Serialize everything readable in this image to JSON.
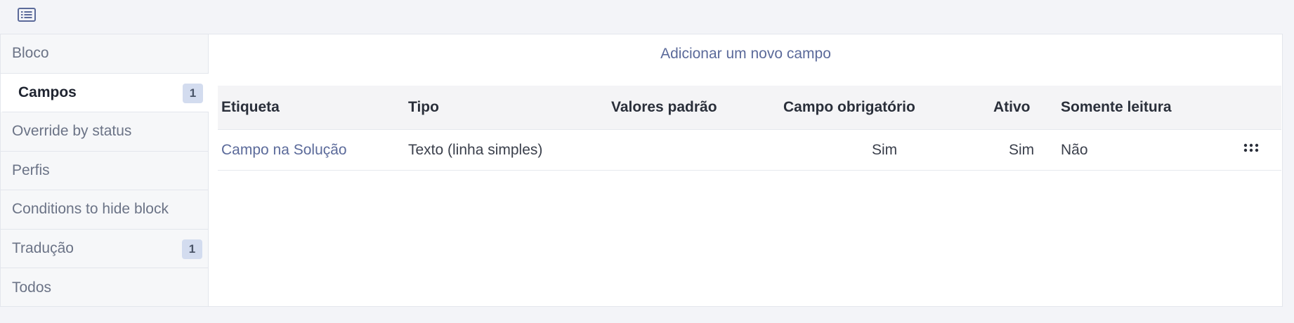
{
  "toolbar": {
    "icon": "list-icon"
  },
  "sidebar": {
    "items": [
      {
        "label": "Bloco",
        "badge": ""
      },
      {
        "label": "Campos",
        "badge": "1",
        "active": true
      },
      {
        "label": "Override by status",
        "badge": ""
      },
      {
        "label": "Perfis",
        "badge": ""
      },
      {
        "label": "Conditions to hide block",
        "badge": ""
      },
      {
        "label": "Tradução",
        "badge": "1"
      },
      {
        "label": "Todos",
        "badge": ""
      }
    ]
  },
  "main": {
    "add_link": "Adicionar um novo campo",
    "table": {
      "headers": [
        "Etiqueta",
        "Tipo",
        "Valores padrão",
        "Campo obrigatório",
        "Ativo",
        "Somente leitura"
      ],
      "rows": [
        {
          "etiqueta": "Campo na Solução",
          "tipo": "Texto (linha simples)",
          "valores": "",
          "obrigatorio": "Sim",
          "ativo": "Sim",
          "leitura": "Não"
        }
      ]
    }
  },
  "colors": {
    "link": "#5b6a9a",
    "badge_bg": "#d3dcef",
    "page_bg": "#f3f4f8"
  }
}
